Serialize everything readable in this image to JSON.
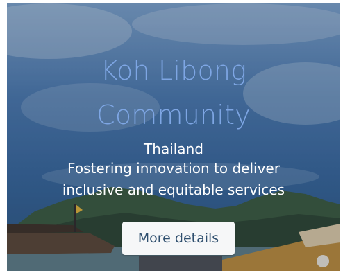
{
  "card": {
    "title_line1": "Koh Libong",
    "title_line2": "Community",
    "country": "Thailand",
    "description_line1": "Fostering innovation to deliver",
    "description_line2": "inclusive and equitable services",
    "button_label": "More details",
    "colors": {
      "title": "#7ea6e4",
      "text": "#ffffff",
      "button_bg": "#f6f7f8",
      "button_text": "#2f4f6e"
    }
  }
}
